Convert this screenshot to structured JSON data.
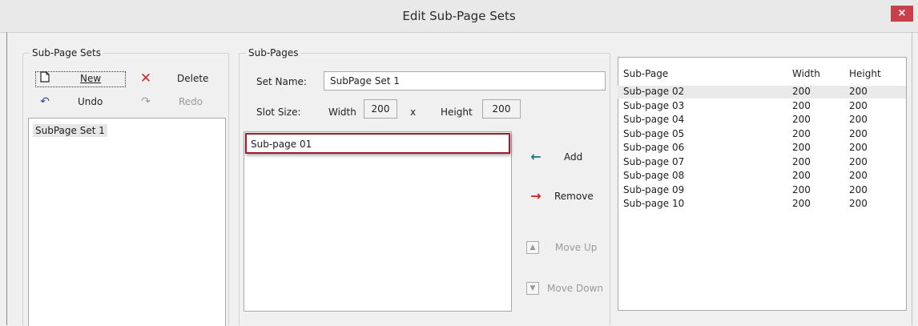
{
  "window": {
    "title": "Edit Sub-Page Sets",
    "close_label": "×"
  },
  "sets_group": {
    "legend": "Sub-Page Sets",
    "toolbar": {
      "new_label": "New",
      "delete_label": "Delete",
      "undo_label": "Undo",
      "redo_label": "Redo"
    },
    "list": [
      "SubPage Set 1"
    ]
  },
  "subpages_group": {
    "legend": "Sub-Pages",
    "set_name_label": "Set Name:",
    "set_name_value": "SubPage Set 1",
    "slot_size_label": "Slot Size:",
    "width_label": "Width",
    "width_value": "200",
    "x_label": "x",
    "height_label": "Height",
    "height_value": "200",
    "assigned_list": [
      "Sub-page 01"
    ],
    "buttons": {
      "add": "Add",
      "remove": "Remove",
      "move_up": "Move Up",
      "move_down": "Move Down"
    }
  },
  "available": {
    "columns": [
      "Sub-Page",
      "Width",
      "Height"
    ],
    "rows": [
      {
        "name": "Sub-page 02",
        "width": "200",
        "height": "200"
      },
      {
        "name": "Sub-page 03",
        "width": "200",
        "height": "200"
      },
      {
        "name": "Sub-page 04",
        "width": "200",
        "height": "200"
      },
      {
        "name": "Sub-page 05",
        "width": "200",
        "height": "200"
      },
      {
        "name": "Sub-page 06",
        "width": "200",
        "height": "200"
      },
      {
        "name": "Sub-page 07",
        "width": "200",
        "height": "200"
      },
      {
        "name": "Sub-page 08",
        "width": "200",
        "height": "200"
      },
      {
        "name": "Sub-page 09",
        "width": "200",
        "height": "200"
      },
      {
        "name": "Sub-page 10",
        "width": "200",
        "height": "200"
      }
    ]
  },
  "colors": {
    "close_button": "#c8414a",
    "highlight_border": "#9e1b2a",
    "add_arrow": "#1c7c7c",
    "remove_arrow": "#d0261e",
    "delete_icon": "#c62828"
  }
}
